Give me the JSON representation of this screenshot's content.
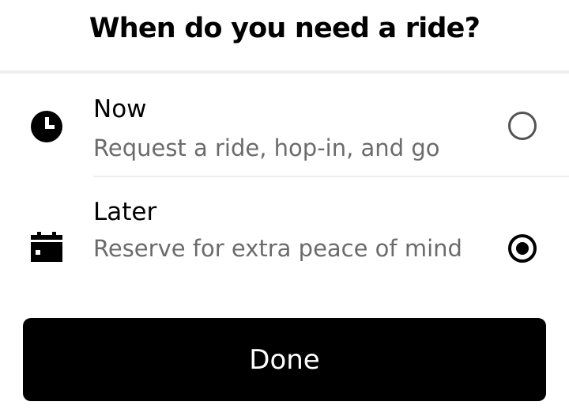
{
  "title": "When do you need a ride?",
  "options": [
    {
      "id": "now",
      "label": "Now",
      "description": "Request a ride, hop-in, and go",
      "icon": "clock-icon",
      "selected": false
    },
    {
      "id": "later",
      "label": "Later",
      "description": "Reserve for extra peace of mind",
      "icon": "calendar-icon",
      "selected": true
    }
  ],
  "done_label": "Done",
  "colors": {
    "primary": "#000000",
    "secondary_text": "#6b6b6b",
    "divider": "#eeeeee",
    "background": "#ffffff",
    "button_text": "#ffffff"
  }
}
